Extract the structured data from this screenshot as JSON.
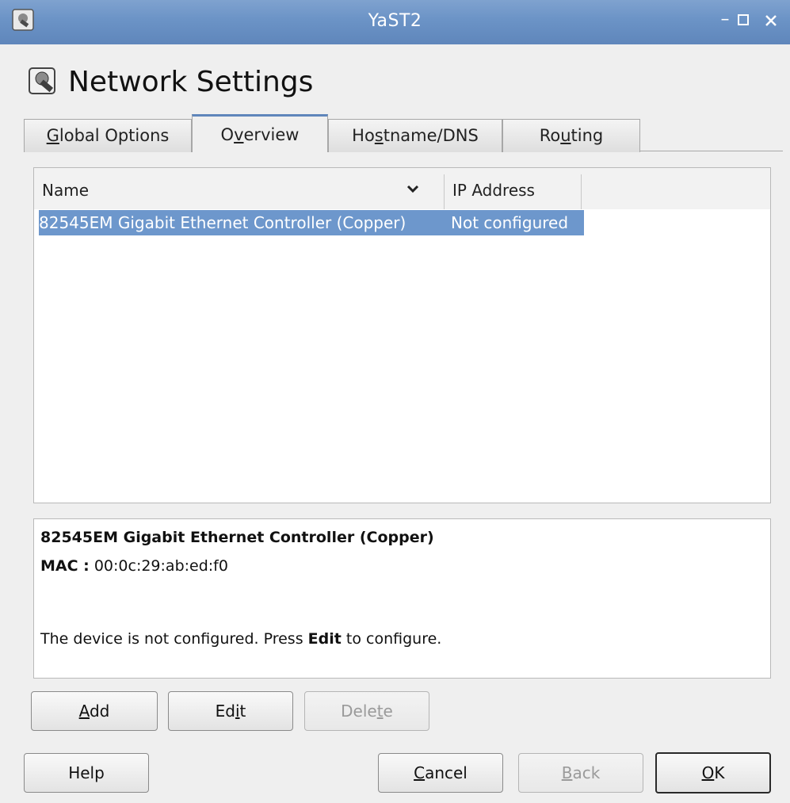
{
  "window": {
    "title": "YaST2",
    "icons": [
      "app-icon",
      "minimize-icon",
      "maximize-icon",
      "close-icon"
    ]
  },
  "page": {
    "title": "Network Settings",
    "icon": "network-settings-icon"
  },
  "tabs": [
    {
      "pre": "",
      "mnemonic": "G",
      "post": "lobal Options",
      "active": false
    },
    {
      "pre": "O",
      "mnemonic": "v",
      "post": "erview",
      "active": true
    },
    {
      "pre": "Ho",
      "mnemonic": "s",
      "post": "tname/DNS",
      "active": false
    },
    {
      "pre": "Ro",
      "mnemonic": "u",
      "post": "ting",
      "active": false
    }
  ],
  "table": {
    "columns": [
      "Name",
      "IP Address"
    ],
    "sort_icon": "chevron-down-icon",
    "rows": [
      {
        "name": "82545EM Gigabit Ethernet Controller (Copper)",
        "ip": "Not configured",
        "selected": true
      }
    ]
  },
  "details": {
    "title": "82545EM Gigabit Ethernet Controller (Copper)",
    "mac_label": "MAC :",
    "mac_value": "00:0c:29:ab:ed:f0",
    "msg_pre": "The device is not configured. Press",
    "msg_bold": "Edit",
    "msg_post": "to configure."
  },
  "buttons": {
    "add": {
      "pre": "",
      "mnemonic": "A",
      "post": "dd"
    },
    "edit": {
      "pre": "Ed",
      "mnemonic": "i",
      "post": "t"
    },
    "delete": {
      "pre": "Dele",
      "mnemonic": "t",
      "post": "e"
    },
    "help": {
      "label": "Help"
    },
    "cancel": {
      "pre": "",
      "mnemonic": "C",
      "post": "ancel"
    },
    "back": {
      "pre": "",
      "mnemonic": "B",
      "post": "ack"
    },
    "ok": {
      "pre": "",
      "mnemonic": "O",
      "post": "K"
    }
  },
  "colors": {
    "titlebar": "#6b93c6",
    "selection": "#6d97cc",
    "active_tab_accent": "#5f86bb"
  }
}
